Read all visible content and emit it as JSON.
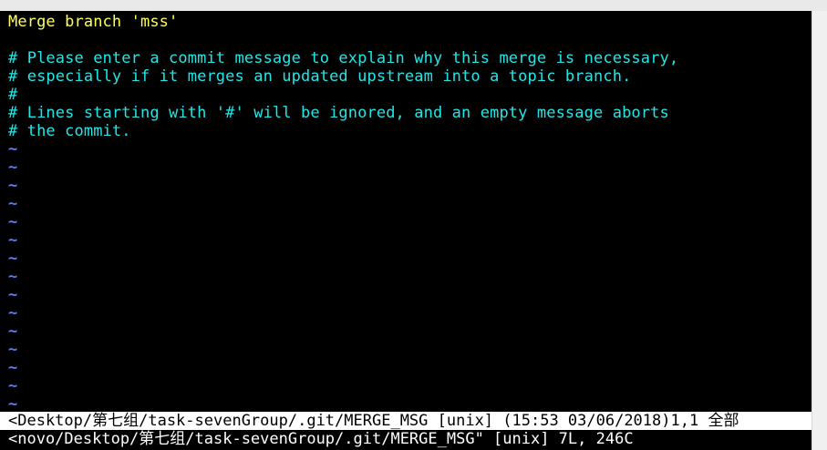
{
  "editor": {
    "lines": [
      "Merge branch 'mss'",
      "",
      "# Please enter a commit message to explain why this merge is necessary,",
      "# especially if it merges an updated upstream into a topic branch.",
      "#",
      "# Lines starting with '#' will be ignored, and an empty message aborts",
      "# the commit."
    ],
    "empty_line_marker": "~"
  },
  "status_bar": {
    "text": "<Desktop/第七组/task-sevenGroup/.git/MERGE_MSG [unix] (15:53 03/06/2018)1,1 全部"
  },
  "message_line": {
    "text": "<novo/Desktop/第七组/task-sevenGroup/.git/MERGE_MSG\" [unix] 7L, 246C"
  },
  "colors": {
    "background": "#000000",
    "first_line": "#ffff57",
    "comment_text": "#22e6e6",
    "tilde": "#5c7cff",
    "status_bar_background": "#ffffff"
  }
}
